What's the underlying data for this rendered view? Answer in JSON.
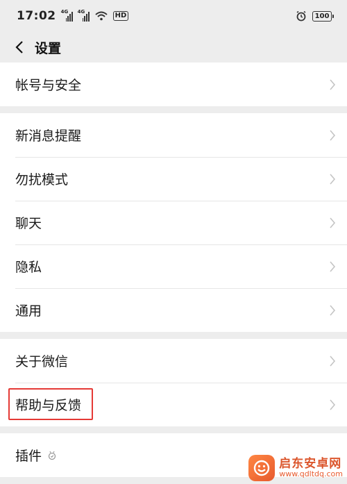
{
  "status_bar": {
    "time": "17:02",
    "network_tag": "4G",
    "hd_label": "HD",
    "battery": "100"
  },
  "nav": {
    "title": "设置"
  },
  "groups": [
    {
      "items": [
        {
          "label": "帐号与安全"
        }
      ]
    },
    {
      "items": [
        {
          "label": "新消息提醒"
        },
        {
          "label": "勿扰模式"
        },
        {
          "label": "聊天"
        },
        {
          "label": "隐私"
        },
        {
          "label": "通用"
        }
      ]
    },
    {
      "items": [
        {
          "label": "关于微信"
        },
        {
          "label": "帮助与反馈",
          "highlighted": true
        }
      ]
    },
    {
      "items": [
        {
          "label": "插件"
        }
      ]
    }
  ],
  "watermark": {
    "title": "启东安卓网",
    "url": "www.qdltdq.com"
  },
  "colors": {
    "background": "#ededed",
    "highlight_border": "#e53935"
  }
}
